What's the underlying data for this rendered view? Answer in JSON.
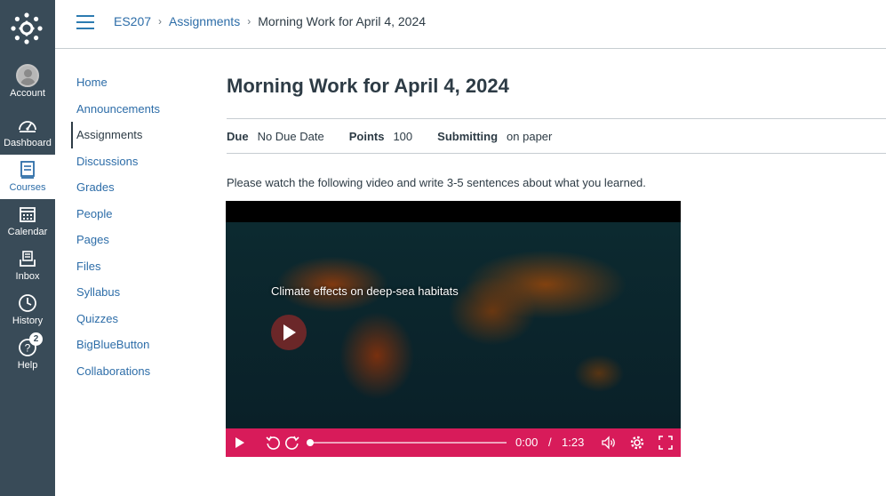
{
  "global_nav": {
    "items": [
      {
        "label": "Account",
        "icon": "avatar"
      },
      {
        "label": "Dashboard",
        "icon": "dashboard-icon"
      },
      {
        "label": "Courses",
        "icon": "book-icon"
      },
      {
        "label": "Calendar",
        "icon": "calendar-icon"
      },
      {
        "label": "Inbox",
        "icon": "inbox-icon"
      },
      {
        "label": "History",
        "icon": "clock-icon"
      },
      {
        "label": "Help",
        "icon": "help-icon",
        "badge": "2"
      }
    ],
    "active": "Courses"
  },
  "breadcrumb": {
    "course": "ES207",
    "section": "Assignments",
    "current": "Morning Work for April 4, 2024"
  },
  "course_nav": {
    "items": [
      "Home",
      "Announcements",
      "Assignments",
      "Discussions",
      "Grades",
      "People",
      "Pages",
      "Files",
      "Syllabus",
      "Quizzes",
      "BigBlueButton",
      "Collaborations"
    ],
    "active": "Assignments"
  },
  "assignment": {
    "title": "Morning Work for April 4, 2024",
    "due_label": "Due",
    "due_value": "No Due Date",
    "points_label": "Points",
    "points_value": "100",
    "submitting_label": "Submitting",
    "submitting_value": "on paper",
    "instructions": "Please watch the following video and write 3-5 sentences about what you learned."
  },
  "video": {
    "title": "Climate effects on deep-sea habitats",
    "current_time": "0:00",
    "separator": "/",
    "duration": "1:23",
    "progress": 0,
    "accent_color": "#d81b5a"
  },
  "colors": {
    "global_nav_bg": "#394B58",
    "link": "#2d6da8",
    "text": "#2D3B45"
  }
}
